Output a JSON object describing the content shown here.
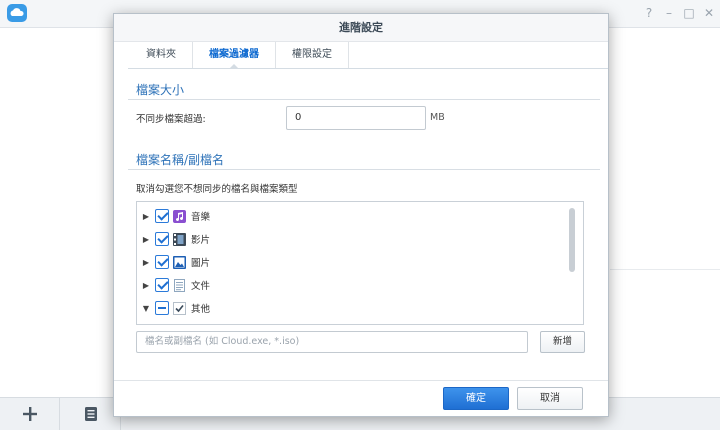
{
  "window": {
    "help_glyph": "?",
    "minimize_glyph": "–",
    "maximize_glyph": "□",
    "close_glyph": "✕"
  },
  "bottom_bar": {
    "add_icon": "plus-icon",
    "list_icon": "list-icon"
  },
  "dialog": {
    "title": "進階設定",
    "tabs": [
      {
        "label": "資料夾",
        "active": false
      },
      {
        "label": "檔案過濾器",
        "active": true
      },
      {
        "label": "權限設定",
        "active": false
      }
    ],
    "size_section": {
      "title": "檔案大小",
      "label": "不同步檔案超過:",
      "value": "0",
      "unit": "MB"
    },
    "name_section": {
      "title": "檔案名稱/副檔名",
      "description": "取消勾選您不想同步的檔名與檔案類型",
      "items": [
        {
          "label": "音樂",
          "state": "checked",
          "icon": "music-icon",
          "expanded": false
        },
        {
          "label": "影片",
          "state": "checked",
          "icon": "video-icon",
          "expanded": false
        },
        {
          "label": "圖片",
          "state": "checked",
          "icon": "image-icon",
          "expanded": false
        },
        {
          "label": "文件",
          "state": "checked",
          "icon": "document-icon",
          "expanded": false
        },
        {
          "label": "其他",
          "state": "partial",
          "icon": "other-icon",
          "expanded": true
        }
      ],
      "pattern_placeholder": "檔名或副檔名 (如 Cloud.exe, *.iso)",
      "add_label": "新增"
    },
    "ok_label": "確定",
    "cancel_label": "取消"
  },
  "colors": {
    "accent": "#1f6fd3",
    "section_title": "#2d72b8"
  }
}
